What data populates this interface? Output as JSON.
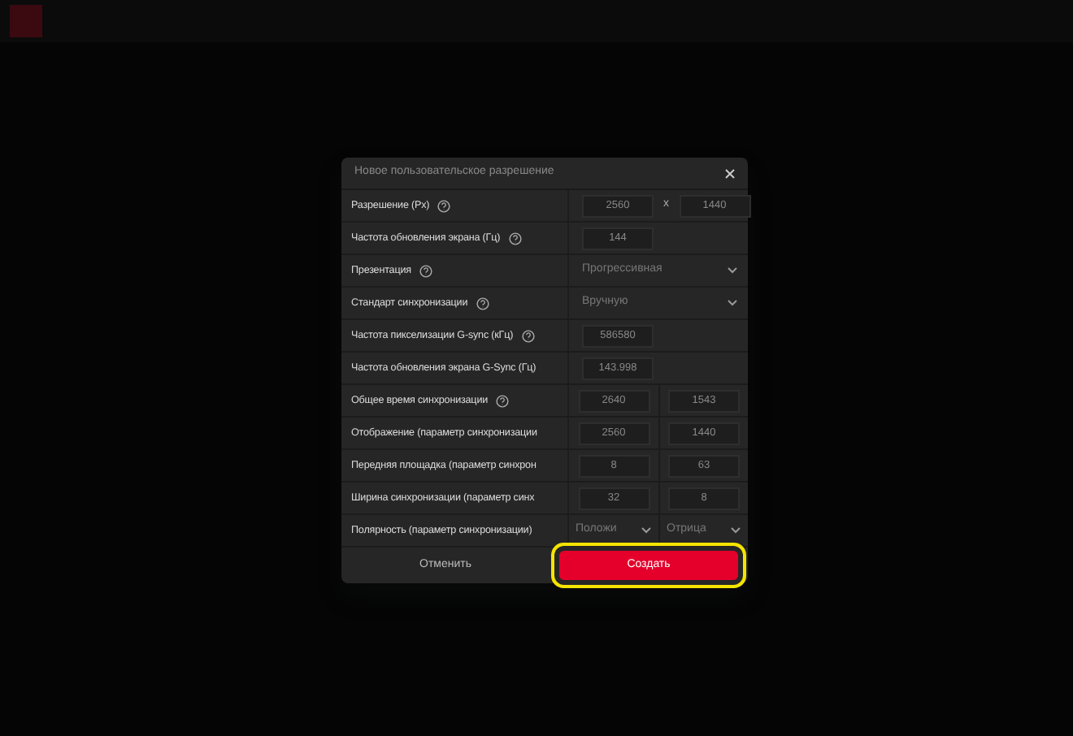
{
  "dialog": {
    "title": "Новое пользовательское разрешение",
    "rows": [
      {
        "kind": "resolution",
        "label": "Разрешение (Px)",
        "help": true,
        "values": [
          "2560",
          "1440"
        ],
        "separator": "x"
      },
      {
        "kind": "single",
        "label": "Частота обновления экрана (Гц)",
        "help": true,
        "values": [
          "144"
        ]
      },
      {
        "kind": "select",
        "label": "Презентация",
        "help": true,
        "values": [
          "Прогрессивная"
        ]
      },
      {
        "kind": "select",
        "label": "Стандарт синхронизации",
        "help": true,
        "values": [
          "Вручную"
        ]
      },
      {
        "kind": "single",
        "label": "Частота пикселизации G-sync (кГц)",
        "help": true,
        "values": [
          "586580"
        ]
      },
      {
        "kind": "single",
        "label": "Частота обновления экрана G-Sync (Гц)",
        "help": false,
        "values": [
          "143.998"
        ]
      },
      {
        "kind": "pair",
        "label": "Общее время синхронизации",
        "help": true,
        "values": [
          "2640",
          "1543"
        ]
      },
      {
        "kind": "pair",
        "label": "Отображение (параметр синхронизации",
        "help": false,
        "values": [
          "2560",
          "1440"
        ]
      },
      {
        "kind": "pair",
        "label": "Передняя площадка (параметр синхрон",
        "help": false,
        "values": [
          "8",
          "63"
        ]
      },
      {
        "kind": "pair",
        "label": "Ширина синхронизации (параметр синх",
        "help": false,
        "values": [
          "32",
          "8"
        ]
      },
      {
        "kind": "selectpair",
        "label": "Полярность (параметр синхронизации)",
        "help": false,
        "values": [
          "Положи",
          "Отрица"
        ]
      }
    ],
    "cancel": "Отменить",
    "create": {
      "label": "Создать",
      "highlighted": true
    }
  }
}
